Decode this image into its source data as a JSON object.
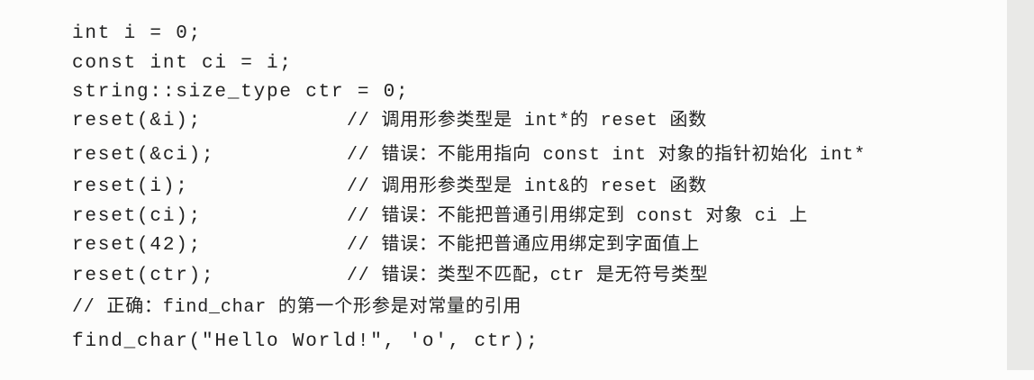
{
  "code_lines": [
    {
      "code": "int i = 0;",
      "comment": ""
    },
    {
      "code": "const int ci = i;",
      "comment": ""
    },
    {
      "code": "string::size_type ctr = 0;",
      "comment": ""
    },
    {
      "code": "reset(&i);",
      "comment": "// 调用形参类型是 int*的 reset 函数"
    },
    {
      "code": "reset(&ci);",
      "comment": "// 错误：不能用指向 const int 对象的指针初始化 int*"
    },
    {
      "code": "reset(i);",
      "comment": "// 调用形参类型是 int&的 reset 函数"
    },
    {
      "code": "reset(ci);",
      "comment": "// 错误：不能把普通引用绑定到 const 对象 ci 上"
    },
    {
      "code": "reset(42);",
      "comment": "// 错误：不能把普通应用绑定到字面值上"
    },
    {
      "code": "reset(ctr);",
      "comment": "// 错误：类型不匹配，ctr 是无符号类型"
    },
    {
      "code": "",
      "comment": "// 正确：find_char 的第一个形参是对常量的引用"
    },
    {
      "code": "find_char(\"Hello World!\", 'o', ctr);",
      "comment": ""
    }
  ]
}
